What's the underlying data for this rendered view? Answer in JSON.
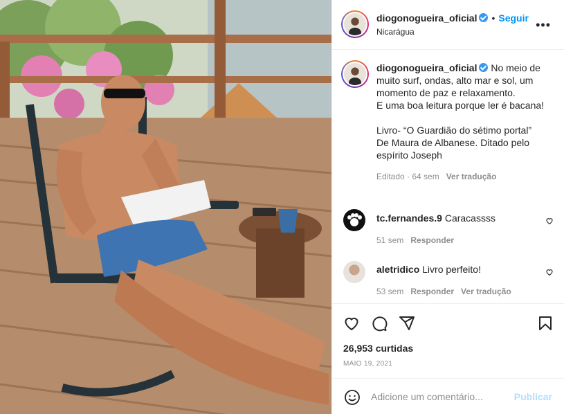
{
  "post": {
    "username": "diogonogueira_oficial",
    "dot": "•",
    "follow_label": "Seguir",
    "location": "Nicarágua",
    "more_label": "•••"
  },
  "caption": {
    "username": "diogonogueira_oficial",
    "text": " No meio de muito surf, ondas, alto mar e sol, um momento de paz e relaxamento.\nE uma boa leitura porque ler é bacana!\n\nLivro- “O Guardião do sétimo portal”\nDe Maura de Albanese. Ditado pelo espírito Joseph",
    "edited": "Editado · 64 sem",
    "see_translation": "Ver tradução"
  },
  "comments": [
    {
      "username": "tc.fernandes.9",
      "text": "Caracassss",
      "time": "51 sem",
      "reply": "Responder",
      "translate": ""
    },
    {
      "username": "aletridico",
      "text": "Livro perfeito!",
      "time": "53 sem",
      "reply": "Responder",
      "translate": "Ver tradução"
    }
  ],
  "stats": {
    "likes": "26,953 curtidas",
    "date": "MAIO 19, 2021"
  },
  "composer": {
    "placeholder": "Adicione um comentário...",
    "publish_label": "Publicar"
  },
  "icons": {
    "like": "heart-icon",
    "comment": "comment-icon",
    "share": "share-icon",
    "save": "bookmark-icon",
    "emoji": "emoji-icon",
    "more": "more-options-icon"
  },
  "colors": {
    "accent": "#0095f6",
    "verified": "#3897f0",
    "muted": "#8e8e8e",
    "publish_disabled": "#b2dffc"
  }
}
